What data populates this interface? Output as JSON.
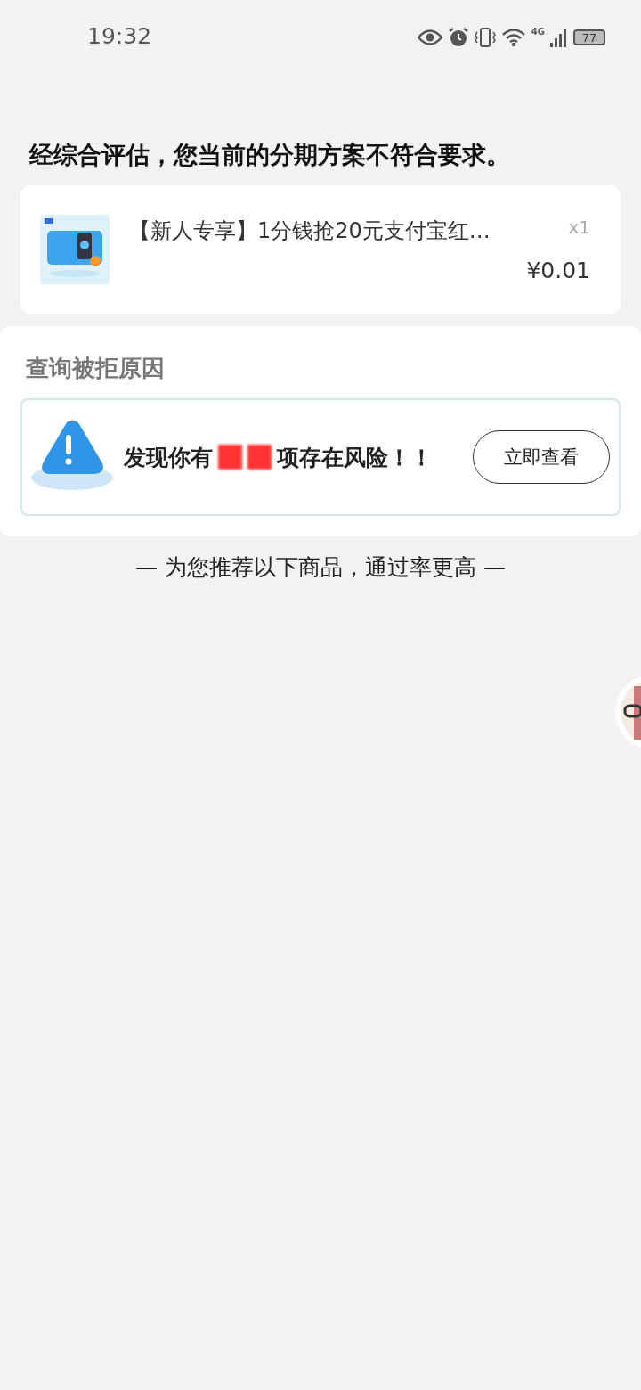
{
  "status_bar": {
    "time": "19:32",
    "battery": "77",
    "network": "4G"
  },
  "headline": "经综合评估，您当前的分期方案不符合要求。",
  "order_item": {
    "title": "【新人专享】1分钱抢20元支付宝红…",
    "quantity": "x1",
    "price": "¥0.01"
  },
  "reasons": {
    "title": "查询被拒原因",
    "risk_text_before": "发现你有",
    "risk_text_after": "项存在风险！！",
    "button": "立即查看"
  },
  "recommend_divider": "— 为您推荐以下商品，通过率更高 —"
}
